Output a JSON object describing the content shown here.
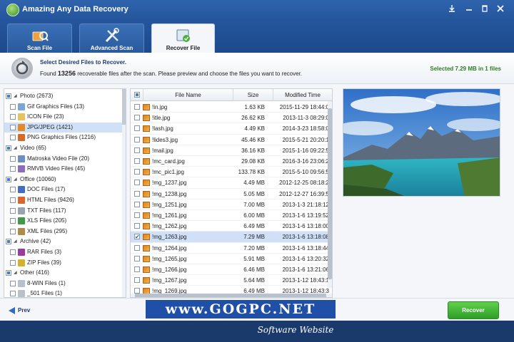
{
  "window": {
    "title": "Amazing Any Data Recovery",
    "controls": [
      "restore-icon",
      "minimize-icon",
      "maximize-icon",
      "close-icon"
    ]
  },
  "tabs": [
    {
      "label": "Scan File",
      "icon": "scan-file-icon",
      "active": false
    },
    {
      "label": "Advanced Scan",
      "icon": "tools-icon",
      "active": false
    },
    {
      "label": "Recover File",
      "icon": "recover-file-icon",
      "active": true
    }
  ],
  "info": {
    "heading": "Select Desired Files to Recover.",
    "found_prefix": "Found",
    "found_count": "13256",
    "found_suffix": "recoverable files after the scan. Please preview and choose the files you want to recover.",
    "selected_summary": "Selected 7.29 MB in 1 files"
  },
  "tree": [
    {
      "label": "Photo (2673)",
      "level": 0,
      "icon": "",
      "selected": false
    },
    {
      "label": "Gif Graphics Files (13)",
      "level": 1,
      "icon": "gif-icon",
      "selected": false
    },
    {
      "label": "ICON File (23)",
      "level": 1,
      "icon": "ico-icon",
      "selected": false
    },
    {
      "label": "JPG/JPEG (1421)",
      "level": 1,
      "icon": "jpg-icon",
      "selected": true
    },
    {
      "label": "PNG Graphics Files (1216)",
      "level": 1,
      "icon": "png-icon",
      "selected": false
    },
    {
      "label": "Video (65)",
      "level": 0,
      "icon": "",
      "selected": false
    },
    {
      "label": "Matroska Video File (20)",
      "level": 1,
      "icon": "mkv-icon",
      "selected": false
    },
    {
      "label": "RMVB Video Files (45)",
      "level": 1,
      "icon": "rmvb-icon",
      "selected": false
    },
    {
      "label": "Office (10060)",
      "level": 0,
      "icon": "",
      "selected": false
    },
    {
      "label": "DOC Files (17)",
      "level": 1,
      "icon": "doc-icon",
      "selected": false
    },
    {
      "label": "HTML Files (9426)",
      "level": 1,
      "icon": "html-icon",
      "selected": false
    },
    {
      "label": "TXT Files (117)",
      "level": 1,
      "icon": "txt-icon",
      "selected": false
    },
    {
      "label": "XLS Files (205)",
      "level": 1,
      "icon": "xls-icon",
      "selected": false
    },
    {
      "label": "XML Files (295)",
      "level": 1,
      "icon": "xml-icon",
      "selected": false
    },
    {
      "label": "Archive (42)",
      "level": 0,
      "icon": "",
      "selected": false
    },
    {
      "label": "RAR Files (3)",
      "level": 1,
      "icon": "rar-icon",
      "selected": false
    },
    {
      "label": "ZIP Files (39)",
      "level": 1,
      "icon": "zip-icon",
      "selected": false
    },
    {
      "label": "Other (416)",
      "level": 0,
      "icon": "",
      "selected": false
    },
    {
      "label": "8-WIN Files (1)",
      "level": 1,
      "icon": "generic-file-icon",
      "selected": false
    },
    {
      "label": "_501 Files (1)",
      "level": 1,
      "icon": "generic-file-icon",
      "selected": false
    }
  ],
  "file_list": {
    "columns": [
      "File Name",
      "Size",
      "Modified Time"
    ],
    "rows": [
      {
        "name": "!in.jpg",
        "size": "1.63 KB",
        "time": "2015-11-29 18:44:0",
        "checked": false
      },
      {
        "name": "!itle.jpg",
        "size": "26.62 KB",
        "time": "2013-11-3 08:29:0",
        "checked": false
      },
      {
        "name": "!lash.jpg",
        "size": "4.49 KB",
        "time": "2014-3-23 18:58:0",
        "checked": false
      },
      {
        "name": "!lides3.jpg",
        "size": "45.46 KB",
        "time": "2015-5-21 20:20:1",
        "checked": false
      },
      {
        "name": "!mail.jpg",
        "size": "36.16 KB",
        "time": "2015-1-16 09:22:5",
        "checked": false
      },
      {
        "name": "!mc_card.jpg",
        "size": "29.08 KB",
        "time": "2016-3-16 23:06:2",
        "checked": false
      },
      {
        "name": "!mc_pic1.jpg",
        "size": "133.78 KB",
        "time": "2015-5-10 09:56:5",
        "checked": false
      },
      {
        "name": "!mg_1237.jpg",
        "size": "4.49 MB",
        "time": "2012-12-25 08:18:2",
        "checked": false
      },
      {
        "name": "!mg_1238.jpg",
        "size": "5.05 MB",
        "time": "2012-12-27 16:39:5",
        "checked": false
      },
      {
        "name": "!mg_1251.jpg",
        "size": "7.00 MB",
        "time": "2013-1-3 21:18:12",
        "checked": false
      },
      {
        "name": "!mg_1261.jpg",
        "size": "6.00 MB",
        "time": "2013-1-6 13:19:52",
        "checked": false
      },
      {
        "name": "!mg_1262.jpg",
        "size": "6.49 MB",
        "time": "2013-1-6 13:18:00",
        "checked": false
      },
      {
        "name": "!mg_1263.jpg",
        "size": "7.29 MB",
        "time": "2013-1-6 13:18:08",
        "checked": true
      },
      {
        "name": "!mg_1264.jpg",
        "size": "7.20 MB",
        "time": "2013-1-6 13:18:44",
        "checked": false
      },
      {
        "name": "!mg_1265.jpg",
        "size": "5.91 MB",
        "time": "2013-1-6 13:20:32",
        "checked": false
      },
      {
        "name": "!mg_1266.jpg",
        "size": "6.46 MB",
        "time": "2013-1-6 13:21:06",
        "checked": false
      },
      {
        "name": "!mg_1267.jpg",
        "size": "5.64 MB",
        "time": "2013-1-12 18:43:1",
        "checked": false
      },
      {
        "name": "!mg_1269.jpg",
        "size": "6.49 MB",
        "time": "2013-1-12 18:43:3",
        "checked": false
      }
    ]
  },
  "preview": {
    "image": "lake-mountain-landscape-photo"
  },
  "footer": {
    "prev_label": "Prev",
    "recover_label": "Recover"
  },
  "watermark": {
    "url": "www.GOGPC.NET",
    "tagline": "Software Website"
  }
}
